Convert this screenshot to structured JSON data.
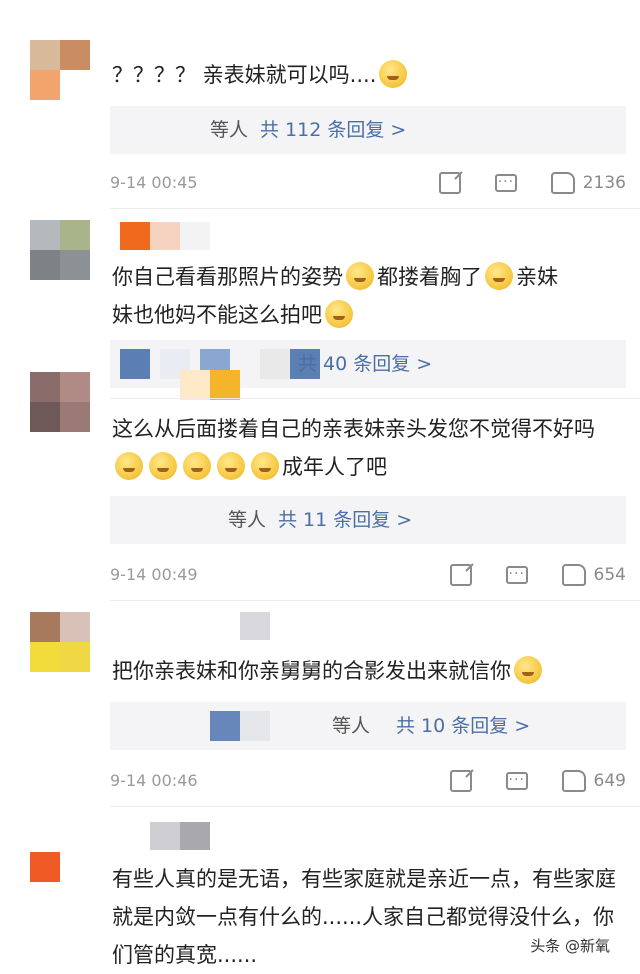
{
  "comments": [
    {
      "text": "？？？？ 亲表妹就可以吗....",
      "reply_who": "等人",
      "reply_count": "共 112 条回复 >",
      "time": "9-14 00:45",
      "likes": "2136"
    },
    {
      "text_a": "你自己看看那照片的姿势",
      "text_b": "都搂着胸了",
      "text_c": "亲妹",
      "text_d": "妹也他妈不能这么拍吧",
      "reply_count": "共 40 条回复 >"
    },
    {
      "text_a": "这么从后面搂着自己的亲表妹亲头发您不觉得不好吗",
      "text_b": "成年人了吧",
      "reply_who": "等人",
      "reply_count": "共 11 条回复 >",
      "time": "9-14 00:49",
      "likes": "654"
    },
    {
      "text": "把你亲表妹和你亲舅舅的合影发出来就信你",
      "reply_who": "等人",
      "reply_count": "共 10 条回复 >",
      "time": "9-14 00:46",
      "likes": "649"
    },
    {
      "text": "有些人真的是无语，有些家庭就是亲近一点，有些家庭就是内敛一点有什么的......人家自己都觉得没什么，你们管的真宽......"
    }
  ],
  "watermark": "头条 @新氧",
  "colors": {
    "reply_link": "#4a6fa5",
    "meta_gray": "#9a9a9a",
    "reply_bg": "#f4f4f6"
  },
  "icons": [
    "share-icon",
    "comment-icon",
    "like-icon",
    "emoji-icon"
  ]
}
